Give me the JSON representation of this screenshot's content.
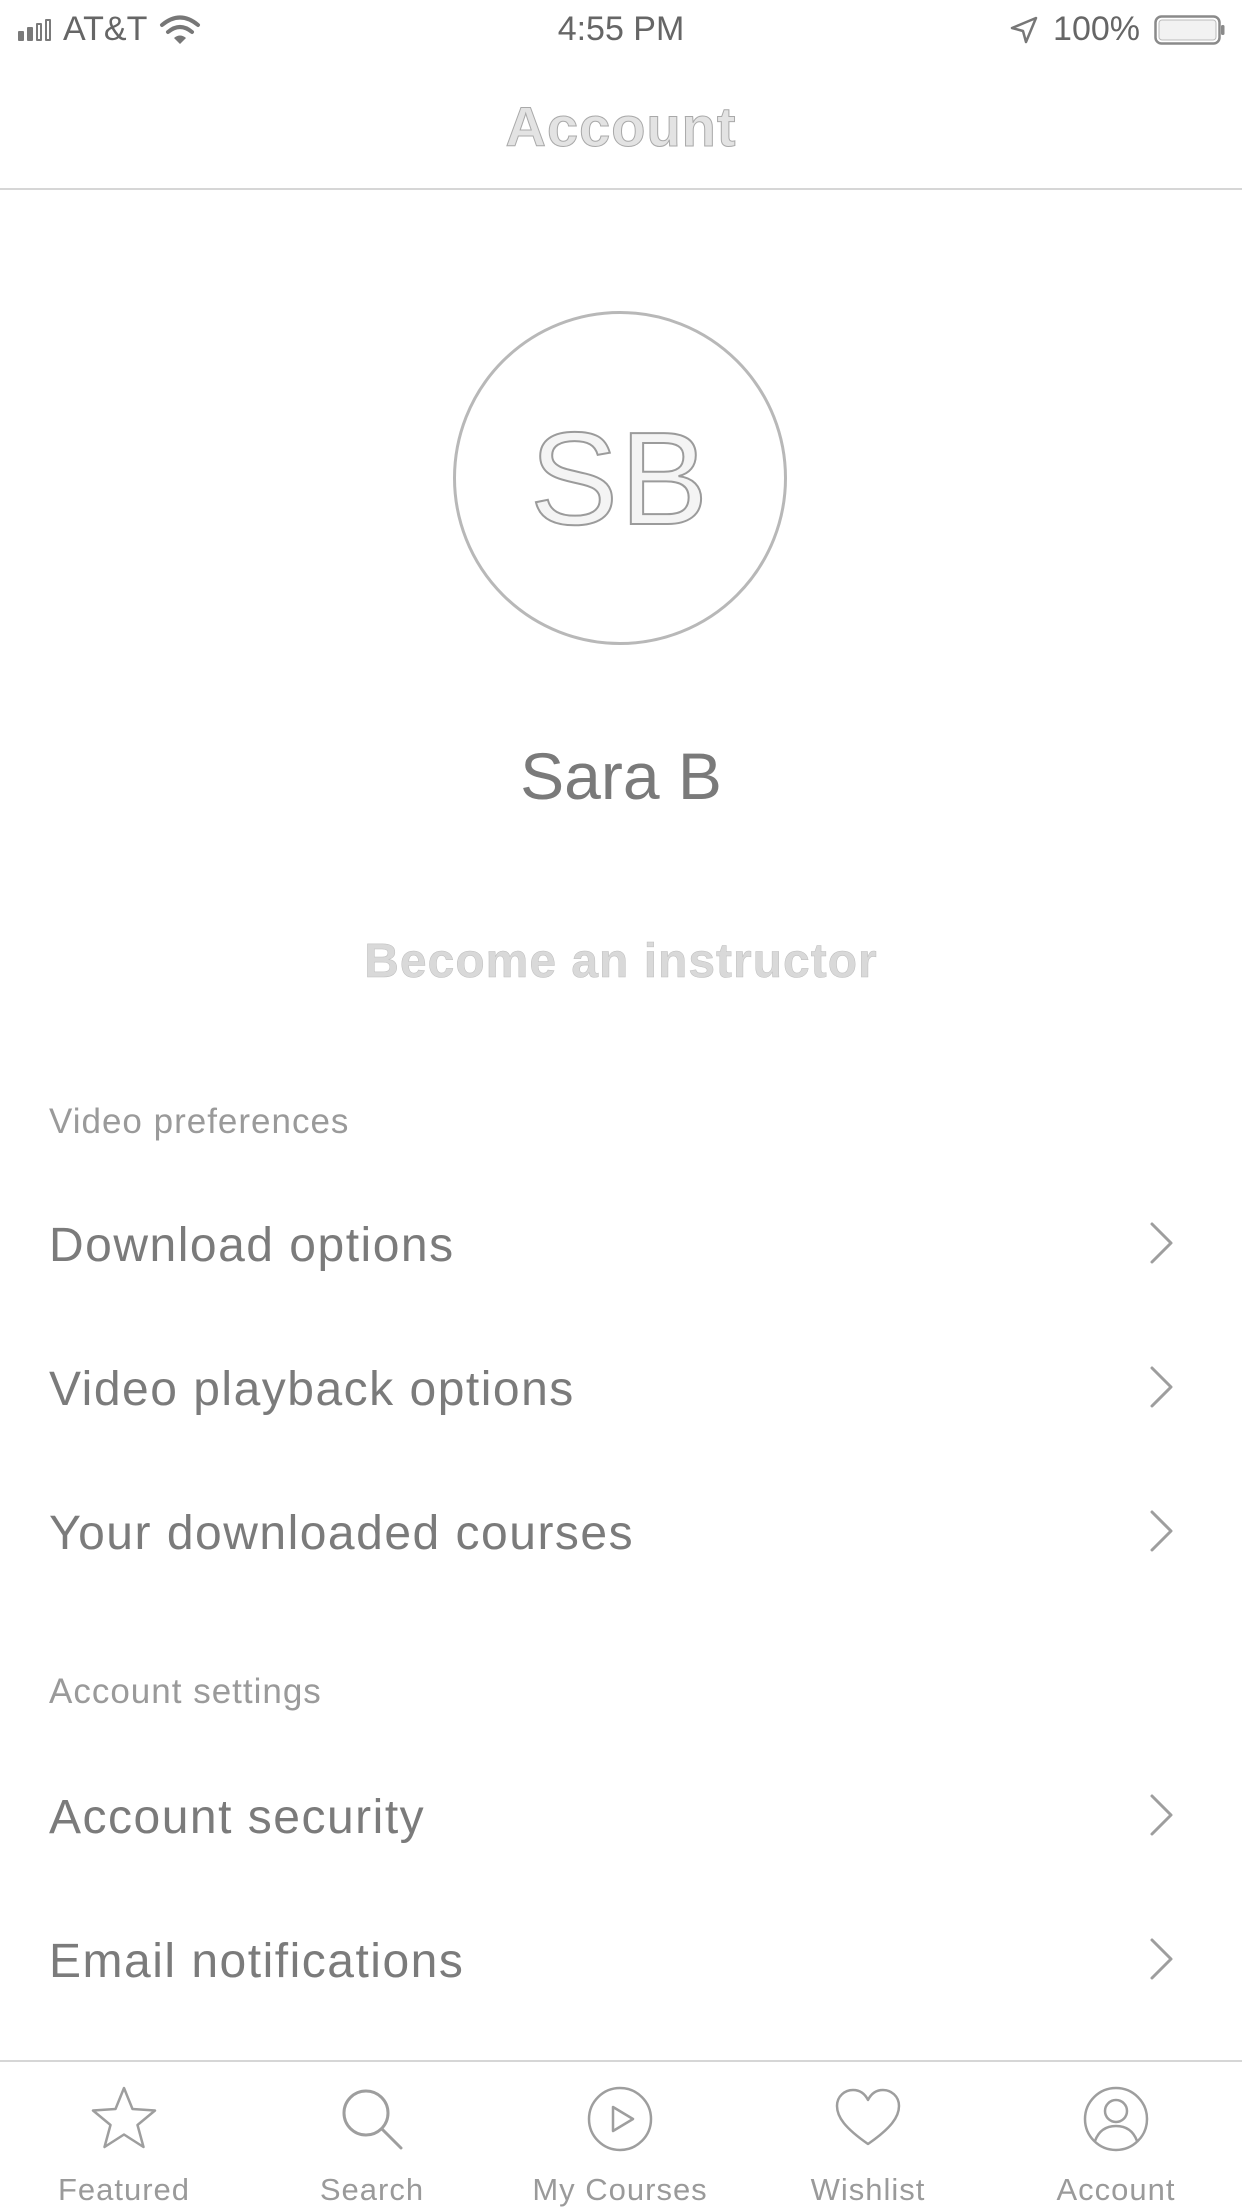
{
  "status_bar": {
    "carrier": "AT&T",
    "time": "4:55 PM",
    "battery": "100%"
  },
  "nav": {
    "title": "Account"
  },
  "profile": {
    "initials": "SB",
    "name": "Sara B",
    "instructor_link": "Become an instructor"
  },
  "sections": [
    {
      "header": "Video preferences",
      "items": [
        {
          "label": "Download options"
        },
        {
          "label": "Video playback options"
        },
        {
          "label": "Your downloaded courses"
        }
      ]
    },
    {
      "header": "Account settings",
      "items": [
        {
          "label": "Account security"
        },
        {
          "label": "Email notifications"
        }
      ]
    }
  ],
  "tabbar": {
    "tabs": [
      {
        "label": "Featured",
        "icon": "star-icon"
      },
      {
        "label": "Search",
        "icon": "search-icon"
      },
      {
        "label": "My Courses",
        "icon": "play-circle-icon"
      },
      {
        "label": "Wishlist",
        "icon": "heart-icon"
      },
      {
        "label": "Account",
        "icon": "user-circle-icon"
      }
    ]
  },
  "colors": {
    "text": "#7b7b7b",
    "muted": "#9a9a9a",
    "divider": "#d6d6d6",
    "background": "#ffffff"
  }
}
